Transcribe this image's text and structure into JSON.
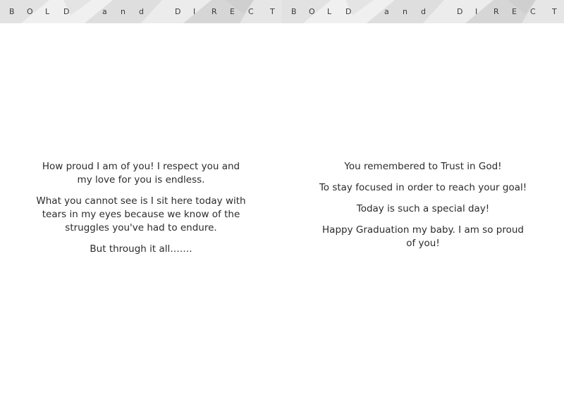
{
  "banner": {
    "letters": [
      "B",
      "O",
      "L",
      "D",
      "a",
      "n",
      "d",
      "D",
      "I",
      "R",
      "E",
      "C",
      "T"
    ]
  },
  "left_page": {
    "paragraphs": [
      "How proud I am of you!  I respect you and my love for you is endless.",
      "What you cannot see is I sit here today with tears in my eyes because we know of the struggles you've had to endure.",
      "But through it all……."
    ]
  },
  "right_page": {
    "paragraphs": [
      "You remembered to Trust in God!",
      "To stay focused in order to reach your goal!",
      "Today is such a special day!",
      "Happy Graduation my baby.   I am so proud of you!"
    ]
  },
  "colors": {
    "banner_background": "#e9e9e9",
    "banner_facets": "#d4d4d4",
    "text": "#2b2b2b"
  }
}
